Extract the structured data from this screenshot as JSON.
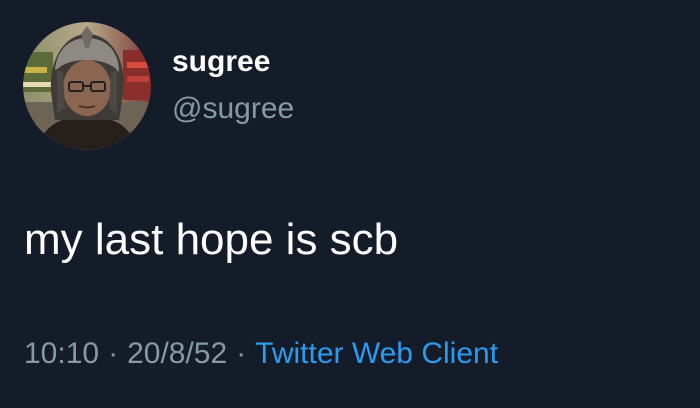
{
  "tweet": {
    "display_name": "sugree",
    "handle": "@sugree",
    "text": "my last hope is scb",
    "time": "10:10",
    "separator": "·",
    "date": "20/8/52",
    "source": "Twitter Web Client"
  },
  "colors": {
    "background": "#151c29",
    "primary_text": "#ffffff",
    "secondary_text": "#8899a6",
    "link": "#2b9bf0"
  },
  "icons": {
    "avatar": "profile-photo"
  }
}
